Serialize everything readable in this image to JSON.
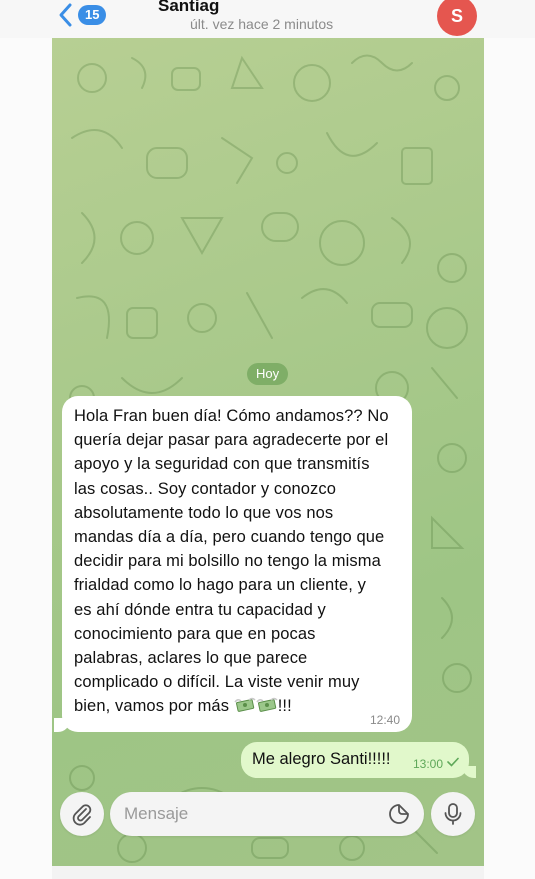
{
  "header": {
    "back_count": "15",
    "contact_name": "Santiag",
    "status": "últ. vez hace 2 minutos",
    "avatar_letter": "S"
  },
  "chat": {
    "date_divider": "Hoy",
    "messages": [
      {
        "direction": "incoming",
        "lines": [
          "Hola Fran buen día! Cómo andamos?? No",
          "quería dejar pasar para agradecerte por el",
          "apoyo y la seguridad con que transmitís",
          "las cosas.. Soy contador y conozco",
          "absolutamente todo lo que vos nos",
          "mandas día a día, pero cuando tengo que",
          "decidir para mi bolsillo no tengo la misma",
          "frialdad como lo hago para un cliente, y",
          "es ahí dónde entra tu capacidad y",
          "conocimiento para que en pocas",
          "palabras, aclares lo que parece",
          "complicado o difícil. La viste venir muy",
          "bien, vamos por más"
        ],
        "tail": "!!!",
        "emoji": "money-with-wings-icon",
        "time": "12:40"
      },
      {
        "direction": "outgoing",
        "text": "Me alegro Santi!!!!!",
        "time": "13:00",
        "status_icon": "read-check-icon"
      }
    ]
  },
  "composer": {
    "placeholder": "Mensaje"
  },
  "colors": {
    "accent": "#3a8ee6",
    "avatar": "#e5564f",
    "outgoing_bubble": "#e1f8cb",
    "chat_bg": "#a9c98b"
  }
}
